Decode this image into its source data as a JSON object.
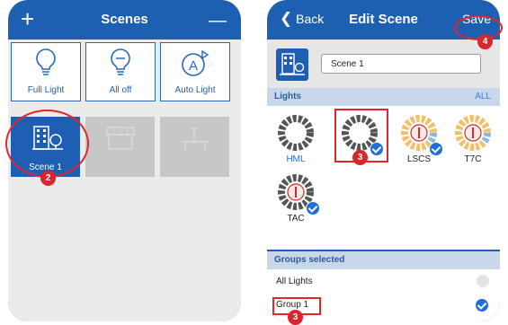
{
  "left": {
    "header": {
      "title": "Scenes",
      "add_glyph": "+",
      "remove_glyph": "—"
    },
    "tiles": [
      {
        "label": "Full Light",
        "icon": "lightbulb-icon"
      },
      {
        "label": "All off",
        "icon": "lightbulb-off-icon"
      },
      {
        "label": "Auto Light",
        "icon": "auto-light-icon"
      }
    ],
    "scenes": [
      {
        "label": "Scene 1",
        "icon": "building-tree-icon",
        "selected": true
      },
      {
        "label": "",
        "icon": "storefront-icon",
        "selected": false
      },
      {
        "label": "",
        "icon": "desk-icon",
        "selected": false
      }
    ],
    "step_badge": "2"
  },
  "right": {
    "header": {
      "back_label": "Back",
      "title": "Edit Scene",
      "save_label": "Save"
    },
    "scene_name": "Scene 1",
    "lights_header": "Lights",
    "all_label": "ALL",
    "lights": [
      {
        "label": "HML",
        "label_color": "#1e6fd6",
        "checked": false,
        "type": "gray-ring"
      },
      {
        "label": "",
        "checked": true,
        "type": "gray-ring"
      },
      {
        "label": "LSCS",
        "checked": true,
        "type": "color-ring"
      },
      {
        "label": "T7C",
        "checked": false,
        "type": "color-ring"
      },
      {
        "label": "TAC",
        "checked": true,
        "type": "gray-ring"
      }
    ],
    "groups_header": "Groups selected",
    "groups": [
      {
        "label": "All Lights",
        "checked": false
      },
      {
        "label": "Group 1",
        "checked": true
      }
    ],
    "badges": {
      "light_step": "3",
      "save_step": "4",
      "group_step": "3"
    }
  },
  "colors": {
    "brand_blue": "#1d5fb0",
    "check_blue": "#1e6fd6",
    "highlight_red": "#e3262c"
  }
}
